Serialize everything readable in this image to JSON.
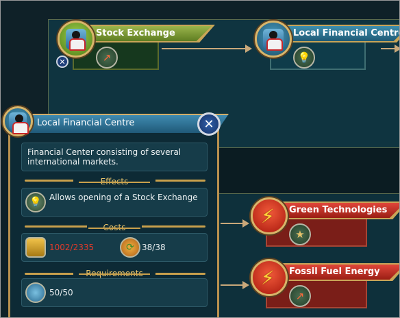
{
  "tree": {
    "nodes": [
      {
        "name": "Stock Exchange",
        "theme": "green",
        "badge_icon": "chart-up-icon"
      },
      {
        "name": "Local Financial Centre",
        "theme": "blue",
        "badge_icon": "lightbulb-icon"
      },
      {
        "name": "Green Technologies",
        "theme": "red",
        "badge_icon": "star-medal-icon"
      },
      {
        "name": "Fossil Fuel Energy",
        "theme": "red",
        "badge_icon": "chart-up-icon"
      }
    ]
  },
  "popup": {
    "title": "Local Financial Centre",
    "description": "Financial Center consisting of several international markets.",
    "effects_title": "Effects",
    "effect_text": "Allows opening of a Stock Exchange",
    "costs_title": "Costs",
    "cost_money": "1002/2335",
    "cost_cycle": "38/38",
    "requirements_title": "Requirements",
    "requirement_value": "50/50"
  },
  "colors": {
    "insufficient": "#e23a2a",
    "gold": "#e7c36b"
  }
}
